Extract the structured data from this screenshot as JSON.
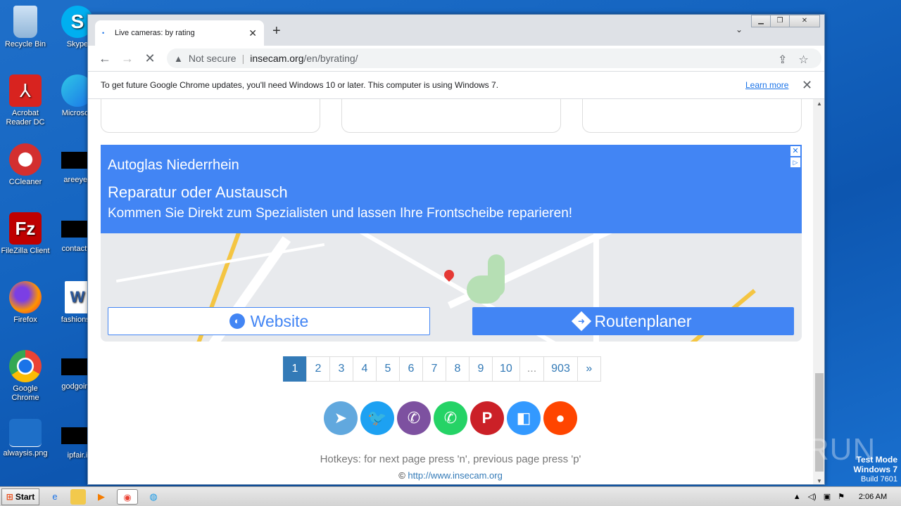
{
  "desktop": {
    "icons": [
      {
        "label": "Recycle Bin"
      },
      {
        "label": "Skype"
      },
      {
        "label": "Acrobat Reader DC"
      },
      {
        "label": "Microsoft"
      },
      {
        "label": "CCleaner"
      },
      {
        "label": "areeyes"
      },
      {
        "label": "FileZilla Client"
      },
      {
        "label": "contactfri"
      },
      {
        "label": "Firefox"
      },
      {
        "label": "fashionsy"
      },
      {
        "label": "Google Chrome"
      },
      {
        "label": "godgoing"
      },
      {
        "label": "alwaysis.png"
      },
      {
        "label": "ipfair.i"
      }
    ]
  },
  "browser": {
    "tab": {
      "title": "Live cameras: by rating"
    },
    "omnibox": {
      "security": "Not secure",
      "host": "insecam.org",
      "path": "/en/byrating/"
    },
    "infobar": {
      "message": "To get future Google Chrome updates, you'll need Windows 10 or later. This computer is using Windows 7.",
      "link": "Learn more"
    }
  },
  "ad": {
    "line1": "Autoglas Niederrhein",
    "line2": "Reparatur oder Austausch",
    "line3": "Kommen Sie Direkt zum Spezialisten und lassen Ihre Frontscheibe reparieren!",
    "website_label": "Website",
    "route_label": "Routenplaner",
    "brand_color": "#4285f4"
  },
  "pagination": {
    "pages": [
      "1",
      "2",
      "3",
      "4",
      "5",
      "6",
      "7",
      "8",
      "9",
      "10",
      "...",
      "903",
      "»"
    ],
    "active": "1"
  },
  "share": [
    {
      "name": "telegram",
      "color": "#61a8de",
      "glyph": "➤"
    },
    {
      "name": "twitter",
      "color": "#1da1f2",
      "glyph": "🐦"
    },
    {
      "name": "viber",
      "color": "#7d51a0",
      "glyph": "✆"
    },
    {
      "name": "whatsapp",
      "color": "#25d366",
      "glyph": "✆"
    },
    {
      "name": "pinterest",
      "color": "#cb2027",
      "glyph": "P"
    },
    {
      "name": "delicious",
      "color": "#3399ff",
      "glyph": "◧"
    },
    {
      "name": "reddit",
      "color": "#ff4500",
      "glyph": "●"
    }
  ],
  "footer": {
    "hotkeys": "Hotkeys: for next page press 'n', previous page press 'p'",
    "copy_symbol": "©",
    "copy_link": "http://www.insecam.org"
  },
  "taskbar": {
    "start_label": "Start",
    "time": "2:06 AM"
  },
  "overlay": {
    "watermark": "ANY RUN",
    "testmode_line1": "Test Mode",
    "testmode_line2": "Windows 7",
    "testmode_line3": "Build 7601"
  }
}
